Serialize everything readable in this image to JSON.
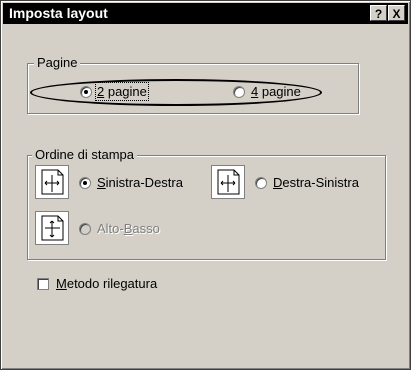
{
  "window": {
    "title": "Imposta layout",
    "help_label": "?",
    "close_label": "X"
  },
  "pagine": {
    "legend": "Pagine",
    "option_2": {
      "mnemonic": "2",
      "rest": " pagine",
      "checked": true
    },
    "option_4": {
      "mnemonic": "4",
      "rest": " pagine",
      "checked": false
    }
  },
  "ordine": {
    "legend": "Ordine di stampa",
    "sinistra_destra": {
      "mnemonic": "S",
      "rest": "inistra-Destra",
      "checked": true,
      "icon": "left-to-right-arrow-icon"
    },
    "destra_sinistra": {
      "mnemonic": "D",
      "rest": "estra-Sinistra",
      "checked": false,
      "icon": "right-to-left-arrow-icon"
    },
    "alto_basso": {
      "pre": "Alto-",
      "mnemonic": "B",
      "rest": "asso",
      "checked": false,
      "disabled": true,
      "icon": "top-to-bottom-arrow-icon"
    }
  },
  "binding": {
    "mnemonic": "M",
    "rest": "etodo rilegatura",
    "checked": false
  }
}
